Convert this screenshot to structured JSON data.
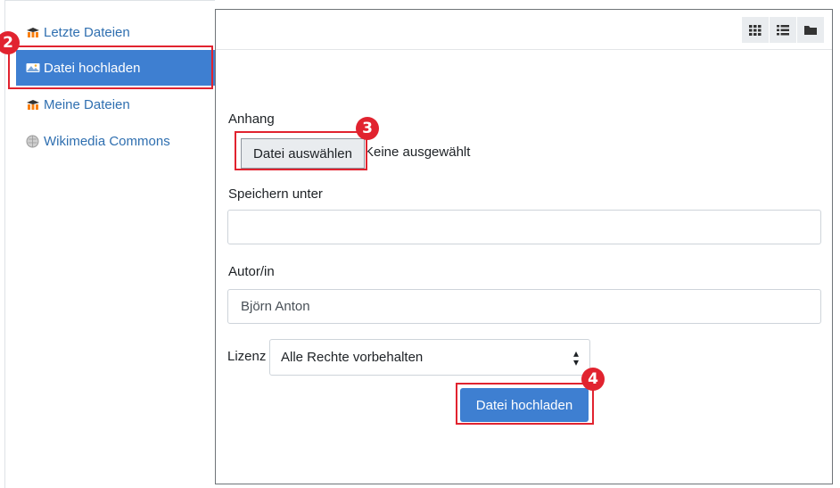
{
  "sidebar": {
    "items": [
      {
        "label": "Letzte Dateien",
        "icon": "moodle-icon"
      },
      {
        "label": "Datei hochladen",
        "icon": "upload-icon",
        "active": true
      },
      {
        "label": "Meine Dateien",
        "icon": "moodle-icon"
      },
      {
        "label": "Wikimedia Commons",
        "icon": "wikimedia-icon"
      }
    ]
  },
  "badges": {
    "b2": "2",
    "b3": "3",
    "b4": "4"
  },
  "toolbar": {
    "views": [
      "grid-view-icon",
      "list-view-icon",
      "folder-view-icon"
    ]
  },
  "form": {
    "attachment_label": "Anhang",
    "choose_file_label": "Datei auswählen",
    "no_file_text": "Keine ausgewählt",
    "save_as_label": "Speichern unter",
    "save_as_value": "",
    "author_label": "Autor/in",
    "author_value": "Björn Anton",
    "license_label": "Lizenz",
    "license_value": "Alle Rechte vorbehalten",
    "upload_button": "Datei hochladen"
  },
  "colors": {
    "accent": "#3e7fd1",
    "highlight": "#e1232f",
    "link": "#2f6fb0"
  }
}
